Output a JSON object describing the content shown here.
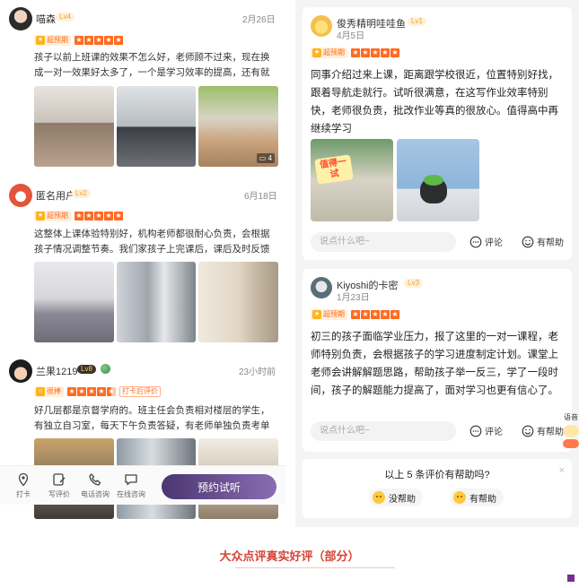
{
  "left_reviews": [
    {
      "user": "喵森",
      "level": "Lv4",
      "date": "2月26日",
      "tag": "超预期",
      "rating": 5,
      "text": "孩子以前上班课的效果不怎么好，老师顾不过来，现在换成一对一效果好太多了，一个是学习效率的提高，还有就是...",
      "photo_count": "4"
    },
    {
      "user": "匿名用户",
      "level": "Lv2",
      "date": "6月18日",
      "tag": "超预期",
      "rating": 5,
      "text": "这整体上课体验特别好，机构老师都很耐心负责，会根据孩子情况调整节奏。我们家孩子上完课后，课后及时反馈学..."
    },
    {
      "user": "兰果1219",
      "level": "Lv8",
      "date": "23小时前",
      "tag": "很棒",
      "rating": 4.5,
      "checkin": "打卡后评价",
      "text": "好几层都是京督学府的。班主任会负责相对楼层的学生，有独立自习室，每天下午负责答疑，有老师单独负责考单词..."
    }
  ],
  "bottom_bar": {
    "items": [
      {
        "label": "打卡",
        "icon": "location-pin-icon"
      },
      {
        "label": "写评价",
        "icon": "write-review-icon"
      },
      {
        "label": "电话咨询",
        "icon": "phone-icon"
      },
      {
        "label": "在线咨询",
        "icon": "chat-icon"
      }
    ],
    "book_button": "预约试听"
  },
  "right_reviews": [
    {
      "user": "俊秀精明哇哇鱼",
      "level": "Lv1",
      "date": "4月5日",
      "tag": "超预期",
      "rating": 5,
      "text": "同事介绍过来上课，距离跟学校很近，位置特别好找，跟着导航走就行。试听很满意，在这写作业效率特别快，老师很负责，批改作业等真的很放心。值得高中再继续学习",
      "photo_badge": "值得一试"
    },
    {
      "user": "Kiyoshi的卡密",
      "level": "Lv3",
      "date": "1月23日",
      "tag": "超预期",
      "rating": 5,
      "text": "初三的孩子面临学业压力，报了这里的一对一课程，老师特别负责，会根据孩子的学习进度制定计划。课堂上老师会讲解解题思路，帮助孩子举一反三，学了一段时间，孩子的解题能力提高了，面对学习也更有信心了。"
    }
  ],
  "comment_placeholder": "说点什么吧~",
  "actions": {
    "comment": "评论",
    "helpful": "有帮助",
    "helpful_cut": "有帮助"
  },
  "helpful_prompt": {
    "question": "以上 5 条评价有帮助吗?",
    "close": "×",
    "no": "没帮助",
    "yes": "有帮助"
  },
  "side_voice_label": "语音",
  "caption": "大众点评真实好评（部分）",
  "colors": {
    "accent": "#ff6a1f",
    "caption": "#d64436",
    "book_button": "#5b4483"
  }
}
